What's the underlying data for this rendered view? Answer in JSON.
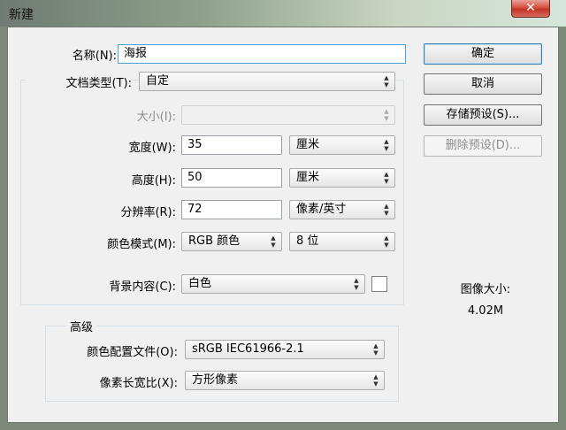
{
  "window": {
    "title": "新建",
    "close_glyph": "✕"
  },
  "form": {
    "name": {
      "label": "名称(N):",
      "value": "海报"
    },
    "doc_type": {
      "label": "文档类型(T):",
      "value": "自定"
    },
    "size": {
      "label": "大小(I):",
      "value": ""
    },
    "width": {
      "label": "宽度(W):",
      "value": "35",
      "unit": "厘米"
    },
    "height": {
      "label": "高度(H):",
      "value": "50",
      "unit": "厘米"
    },
    "resolution": {
      "label": "分辨率(R):",
      "value": "72",
      "unit": "像素/英寸"
    },
    "color_mode": {
      "label": "颜色模式(M):",
      "value": "RGB 颜色",
      "depth": "8 位"
    },
    "background": {
      "label": "背景内容(C):",
      "value": "白色",
      "swatch_color": "#ffffff"
    }
  },
  "advanced": {
    "title": "高级",
    "color_profile": {
      "label": "颜色配置文件(O):",
      "value": "sRGB IEC61966-2.1"
    },
    "pixel_aspect": {
      "label": "像素长宽比(X):",
      "value": "方形像素"
    }
  },
  "buttons": {
    "ok": "确定",
    "cancel": "取消",
    "save_preset": "存储预设(S)...",
    "delete_preset": "删除预设(D)..."
  },
  "image_size": {
    "label": "图像大小:",
    "value": "4.02M"
  }
}
